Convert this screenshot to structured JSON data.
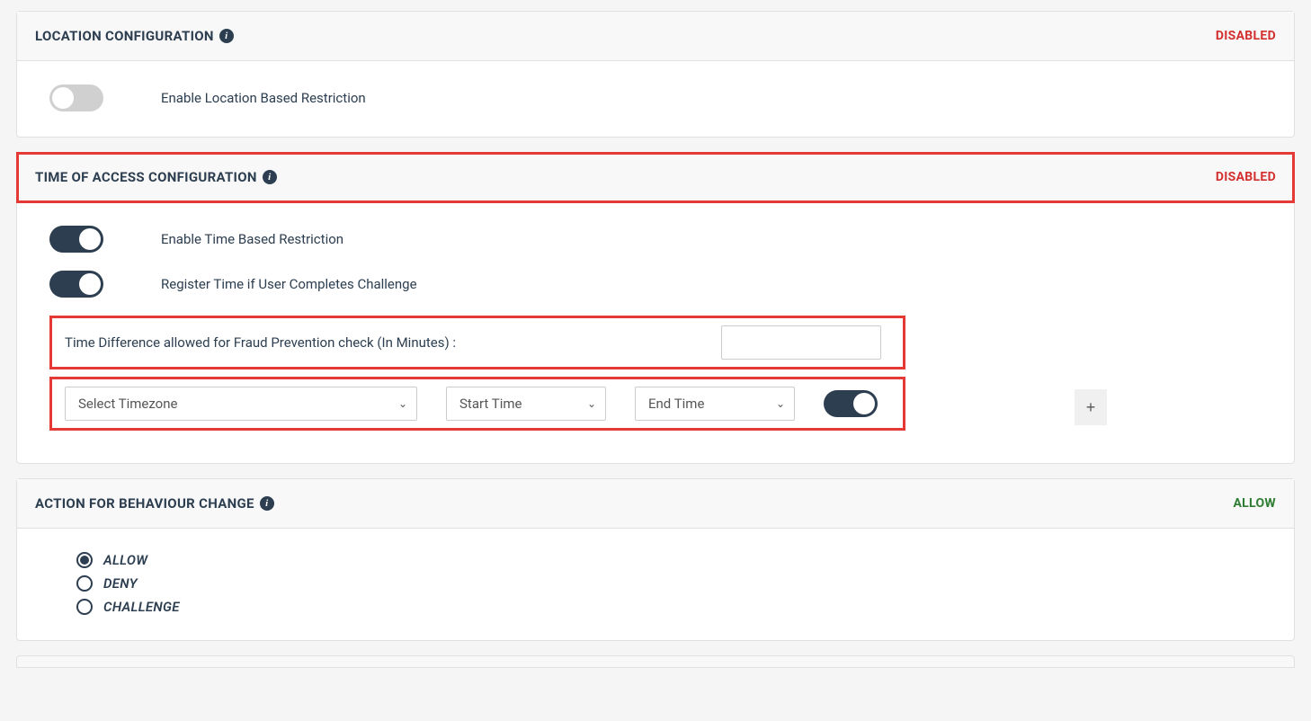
{
  "location": {
    "title": "LOCATION CONFIGURATION",
    "status": "DISABLED",
    "enable_label": "Enable Location Based Restriction"
  },
  "time": {
    "title": "TIME OF ACCESS CONFIGURATION",
    "status": "DISABLED",
    "enable_label": "Enable Time Based Restriction",
    "register_label": "Register Time if User Completes Challenge",
    "diff_label": "Time Difference allowed for Fraud Prevention check (In Minutes) :",
    "timezone_placeholder": "Select Timezone",
    "start_placeholder": "Start Time",
    "end_placeholder": "End Time",
    "add_label": "+"
  },
  "action": {
    "title": "ACTION FOR BEHAVIOUR CHANGE",
    "status": "ALLOW",
    "options": {
      "allow": "ALLOW",
      "deny": "DENY",
      "challenge": "CHALLENGE"
    }
  },
  "info_glyph": "i"
}
